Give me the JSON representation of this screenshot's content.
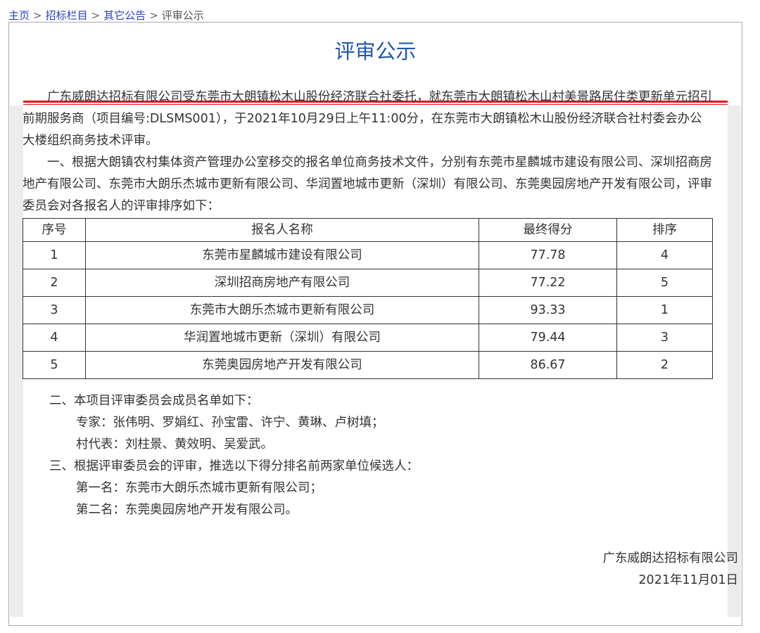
{
  "breadcrumb": [
    "主页",
    "招标栏目",
    "其它公告",
    "评审公示"
  ],
  "breadcrumb_sep": ">",
  "title": "评审公示",
  "intro": "广东威朗达招标有限公司受东莞市大朗镇松木山股份经济联合社委托，就东莞市大朗镇松木山村美景路居住类更新单元招引前期服务商（项目编号:DLSMS001），于2021年10月29日上午11:00分，在东莞市大朗镇松木山股份经济联合社村委会办公大楼组织商务技术评审。",
  "section1": "一、根据大朗镇农村集体资产管理办公室移交的报名单位商务技术文件，分别有东莞市星麟城市建设有限公司、深圳招商房地产有限公司、东莞市大朗乐杰城市更新有限公司、华润置地城市更新（深圳）有限公司、东莞奥园房地产开发有限公司，评审委员会对各报名人的评审排序如下：",
  "table": {
    "headers": [
      "序号",
      "报名人名称",
      "最终得分",
      "排序"
    ],
    "rows": [
      [
        "1",
        "东莞市星麟城市建设有限公司",
        "77.78",
        "4"
      ],
      [
        "2",
        "深圳招商房地产有限公司",
        "77.22",
        "5"
      ],
      [
        "3",
        "东莞市大朗乐杰城市更新有限公司",
        "93.33",
        "1"
      ],
      [
        "4",
        "华润置地城市更新（深圳）有限公司",
        "79.44",
        "3"
      ],
      [
        "5",
        "东莞奥园房地产开发有限公司",
        "86.67",
        "2"
      ]
    ]
  },
  "section2": "二、本项目评审委员会成员名单如下：",
  "experts": "专家：张伟明、罗娟红、孙宝雷、许宁、黄琳、卢树填；",
  "village_reps": "村代表：刘柱景、黄效明、吴爱武。",
  "section3": "三、根据评审委员会的评审，推选以下得分排名前两家单位候选人：",
  "first": "第一名：东莞市大朗乐杰城市更新有限公司；",
  "second": "第二名：东莞奥园房地产开发有限公司。",
  "signature_company": "广东威朗达招标有限公司",
  "signature_date": "2021年11月01日"
}
